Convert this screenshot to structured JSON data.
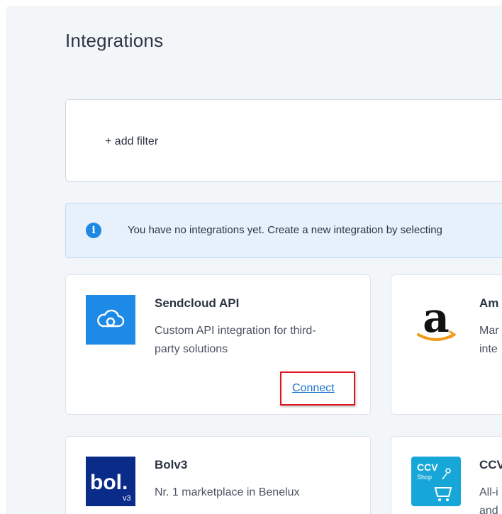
{
  "page": {
    "title": "Integrations"
  },
  "filter": {
    "add_label": "+ add filter"
  },
  "info": {
    "message": "You have no integrations yet. Create a new integration by selecting",
    "icon": "info-icon",
    "color": "#1e88e5"
  },
  "integrations": [
    {
      "title": "Sendcloud API",
      "description": "Custom API integration for third-party solutions",
      "action": "Connect",
      "icon": "cloud-icon",
      "color": "#1e8ae8"
    },
    {
      "title": "Am",
      "description": "Mar inte",
      "icon": "amazon-logo"
    },
    {
      "title": "Bolv3",
      "description": "Nr. 1 marketplace in Benelux",
      "icon": "bol-logo",
      "logo_text": "bol.",
      "logo_sub": "v3",
      "color": "#0a2b88"
    },
    {
      "title": "CCV",
      "description": "All-i and",
      "icon": "ccv-shop-logo",
      "logo_text": "CCV",
      "logo_sub": "Shop",
      "color": "#16a7d8"
    }
  ],
  "colors": {
    "background": "#f3f6f9",
    "link": "#1a73c9",
    "highlight_border": "#e0141e"
  }
}
